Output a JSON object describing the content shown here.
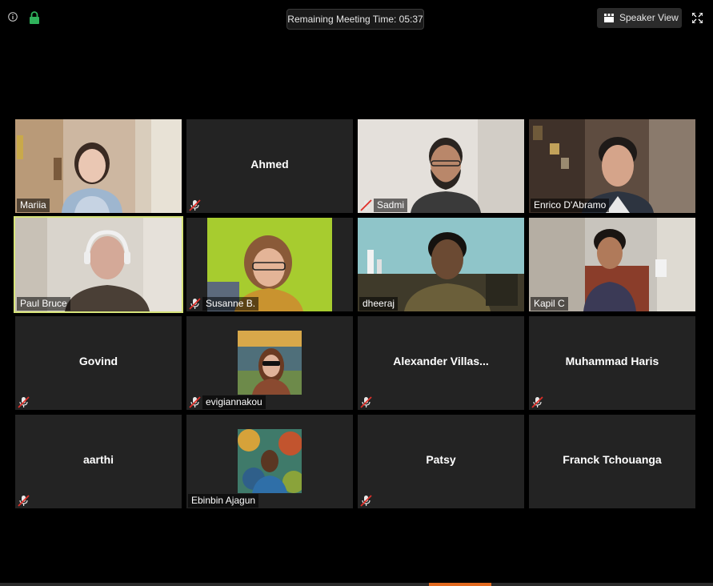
{
  "toolbar": {
    "meeting_time_label": "Remaining Meeting Time: 05:37",
    "speaker_view_label": "Speaker View",
    "info_icon": "info-icon",
    "lock_icon": "lock-icon",
    "fullscreen_icon": "fullscreen-icon"
  },
  "colors": {
    "background": "#000000",
    "tile": "#232323",
    "active_border": "#d7e47a",
    "lock_green": "#2fb25b",
    "mute_red": "#e0302a",
    "accent_orange": "#e2691e"
  },
  "participants": [
    {
      "name": "Mariia",
      "muted": false,
      "video": true
    },
    {
      "name": "Ahmed",
      "muted": true,
      "video": false
    },
    {
      "name": "Sadmi",
      "muted": true,
      "video": true
    },
    {
      "name": "Enrico D'Abramo",
      "muted": false,
      "video": true
    },
    {
      "name": "Paul Bruce",
      "muted": false,
      "video": true,
      "active_speaker": true
    },
    {
      "name": "Susanne B.",
      "muted": true,
      "video": true
    },
    {
      "name": "dheeraj",
      "muted": false,
      "video": true
    },
    {
      "name": "Kapil C",
      "muted": false,
      "video": true
    },
    {
      "name": "Govind",
      "muted": true,
      "video": false
    },
    {
      "name": "evigiannakou",
      "muted": true,
      "video": false,
      "avatar": true
    },
    {
      "name": "Alexander  Villas...",
      "muted": true,
      "video": false
    },
    {
      "name": "Muhammad Haris",
      "muted": true,
      "video": false
    },
    {
      "name": "aarthi",
      "muted": true,
      "video": false
    },
    {
      "name": "Ebinbin Ajagun",
      "muted": false,
      "video": false,
      "avatar": true
    },
    {
      "name": "Patsy",
      "muted": true,
      "video": false
    },
    {
      "name": "Franck Tchouanga",
      "muted": false,
      "video": false
    }
  ]
}
